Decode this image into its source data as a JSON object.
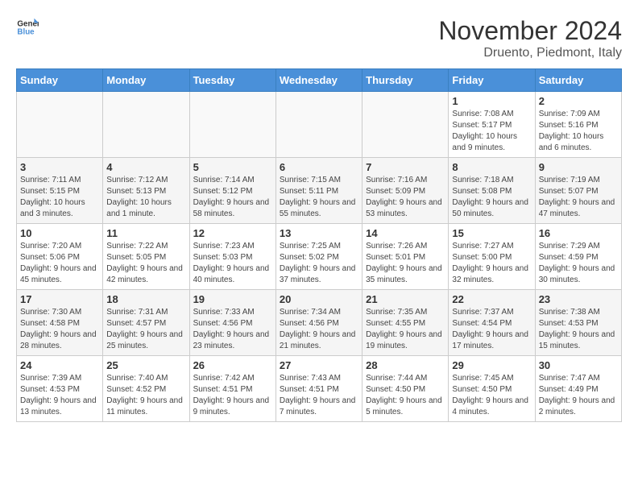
{
  "header": {
    "logo_line1": "General",
    "logo_line2": "Blue",
    "month": "November 2024",
    "location": "Druento, Piedmont, Italy"
  },
  "days_of_week": [
    "Sunday",
    "Monday",
    "Tuesday",
    "Wednesday",
    "Thursday",
    "Friday",
    "Saturday"
  ],
  "weeks": [
    [
      {
        "day": "",
        "info": ""
      },
      {
        "day": "",
        "info": ""
      },
      {
        "day": "",
        "info": ""
      },
      {
        "day": "",
        "info": ""
      },
      {
        "day": "",
        "info": ""
      },
      {
        "day": "1",
        "info": "Sunrise: 7:08 AM\nSunset: 5:17 PM\nDaylight: 10 hours and 9 minutes."
      },
      {
        "day": "2",
        "info": "Sunrise: 7:09 AM\nSunset: 5:16 PM\nDaylight: 10 hours and 6 minutes."
      }
    ],
    [
      {
        "day": "3",
        "info": "Sunrise: 7:11 AM\nSunset: 5:15 PM\nDaylight: 10 hours and 3 minutes."
      },
      {
        "day": "4",
        "info": "Sunrise: 7:12 AM\nSunset: 5:13 PM\nDaylight: 10 hours and 1 minute."
      },
      {
        "day": "5",
        "info": "Sunrise: 7:14 AM\nSunset: 5:12 PM\nDaylight: 9 hours and 58 minutes."
      },
      {
        "day": "6",
        "info": "Sunrise: 7:15 AM\nSunset: 5:11 PM\nDaylight: 9 hours and 55 minutes."
      },
      {
        "day": "7",
        "info": "Sunrise: 7:16 AM\nSunset: 5:09 PM\nDaylight: 9 hours and 53 minutes."
      },
      {
        "day": "8",
        "info": "Sunrise: 7:18 AM\nSunset: 5:08 PM\nDaylight: 9 hours and 50 minutes."
      },
      {
        "day": "9",
        "info": "Sunrise: 7:19 AM\nSunset: 5:07 PM\nDaylight: 9 hours and 47 minutes."
      }
    ],
    [
      {
        "day": "10",
        "info": "Sunrise: 7:20 AM\nSunset: 5:06 PM\nDaylight: 9 hours and 45 minutes."
      },
      {
        "day": "11",
        "info": "Sunrise: 7:22 AM\nSunset: 5:05 PM\nDaylight: 9 hours and 42 minutes."
      },
      {
        "day": "12",
        "info": "Sunrise: 7:23 AM\nSunset: 5:03 PM\nDaylight: 9 hours and 40 minutes."
      },
      {
        "day": "13",
        "info": "Sunrise: 7:25 AM\nSunset: 5:02 PM\nDaylight: 9 hours and 37 minutes."
      },
      {
        "day": "14",
        "info": "Sunrise: 7:26 AM\nSunset: 5:01 PM\nDaylight: 9 hours and 35 minutes."
      },
      {
        "day": "15",
        "info": "Sunrise: 7:27 AM\nSunset: 5:00 PM\nDaylight: 9 hours and 32 minutes."
      },
      {
        "day": "16",
        "info": "Sunrise: 7:29 AM\nSunset: 4:59 PM\nDaylight: 9 hours and 30 minutes."
      }
    ],
    [
      {
        "day": "17",
        "info": "Sunrise: 7:30 AM\nSunset: 4:58 PM\nDaylight: 9 hours and 28 minutes."
      },
      {
        "day": "18",
        "info": "Sunrise: 7:31 AM\nSunset: 4:57 PM\nDaylight: 9 hours and 25 minutes."
      },
      {
        "day": "19",
        "info": "Sunrise: 7:33 AM\nSunset: 4:56 PM\nDaylight: 9 hours and 23 minutes."
      },
      {
        "day": "20",
        "info": "Sunrise: 7:34 AM\nSunset: 4:56 PM\nDaylight: 9 hours and 21 minutes."
      },
      {
        "day": "21",
        "info": "Sunrise: 7:35 AM\nSunset: 4:55 PM\nDaylight: 9 hours and 19 minutes."
      },
      {
        "day": "22",
        "info": "Sunrise: 7:37 AM\nSunset: 4:54 PM\nDaylight: 9 hours and 17 minutes."
      },
      {
        "day": "23",
        "info": "Sunrise: 7:38 AM\nSunset: 4:53 PM\nDaylight: 9 hours and 15 minutes."
      }
    ],
    [
      {
        "day": "24",
        "info": "Sunrise: 7:39 AM\nSunset: 4:53 PM\nDaylight: 9 hours and 13 minutes."
      },
      {
        "day": "25",
        "info": "Sunrise: 7:40 AM\nSunset: 4:52 PM\nDaylight: 9 hours and 11 minutes."
      },
      {
        "day": "26",
        "info": "Sunrise: 7:42 AM\nSunset: 4:51 PM\nDaylight: 9 hours and 9 minutes."
      },
      {
        "day": "27",
        "info": "Sunrise: 7:43 AM\nSunset: 4:51 PM\nDaylight: 9 hours and 7 minutes."
      },
      {
        "day": "28",
        "info": "Sunrise: 7:44 AM\nSunset: 4:50 PM\nDaylight: 9 hours and 5 minutes."
      },
      {
        "day": "29",
        "info": "Sunrise: 7:45 AM\nSunset: 4:50 PM\nDaylight: 9 hours and 4 minutes."
      },
      {
        "day": "30",
        "info": "Sunrise: 7:47 AM\nSunset: 4:49 PM\nDaylight: 9 hours and 2 minutes."
      }
    ]
  ]
}
